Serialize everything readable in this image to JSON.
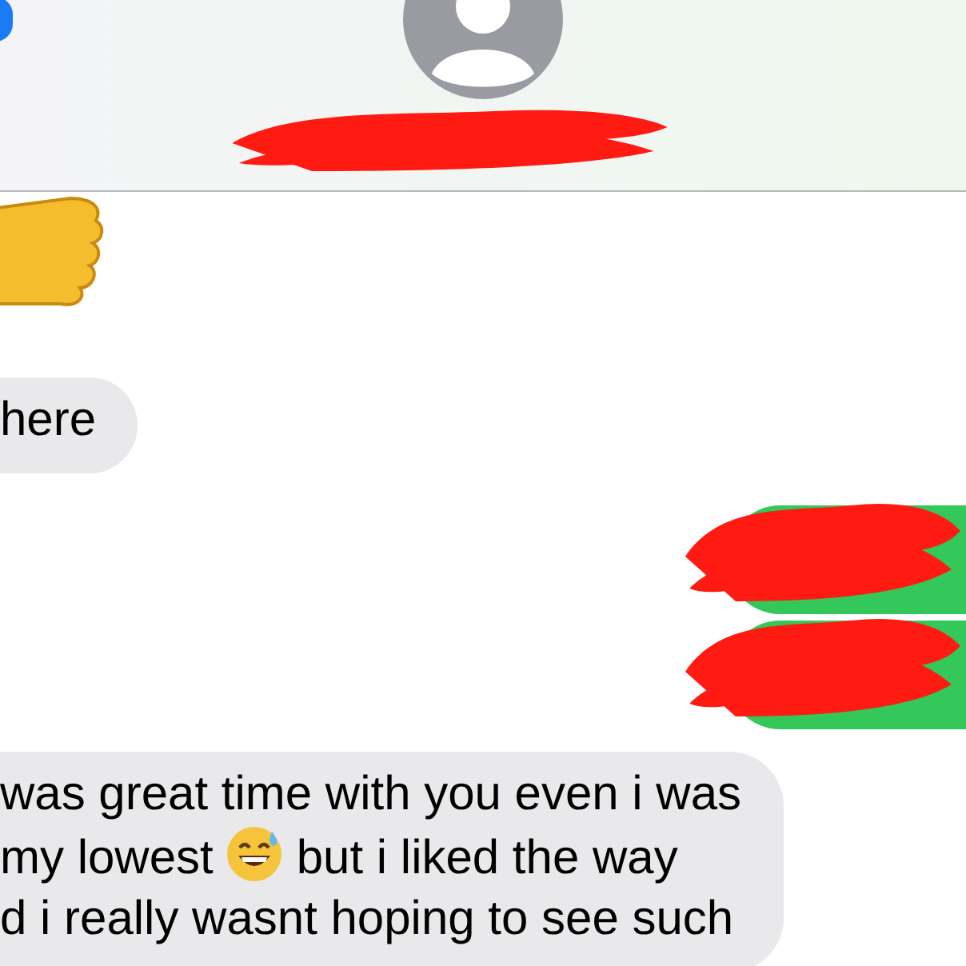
{
  "messages": [
    {
      "outgoing": false,
      "kind": "sticker"
    },
    {
      "outgoing": false,
      "kind": "text",
      "lines": [
        [
          {
            "kind": "text",
            "text": "here"
          }
        ]
      ]
    },
    {
      "outgoing": true,
      "kind": "redacted"
    },
    {
      "outgoing": true,
      "kind": "redacted"
    },
    {
      "outgoing": false,
      "kind": "text",
      "lines": [
        [
          {
            "kind": "text",
            "text": "was great time with you even i was"
          }
        ],
        [
          {
            "kind": "text",
            "text": "my lowest"
          },
          {
            "kind": "emoji"
          },
          {
            "kind": "text",
            "text": "but i liked the way"
          }
        ],
        [
          {
            "kind": "text",
            "text": "d i really wasnt hoping to see such"
          }
        ]
      ]
    }
  ]
}
